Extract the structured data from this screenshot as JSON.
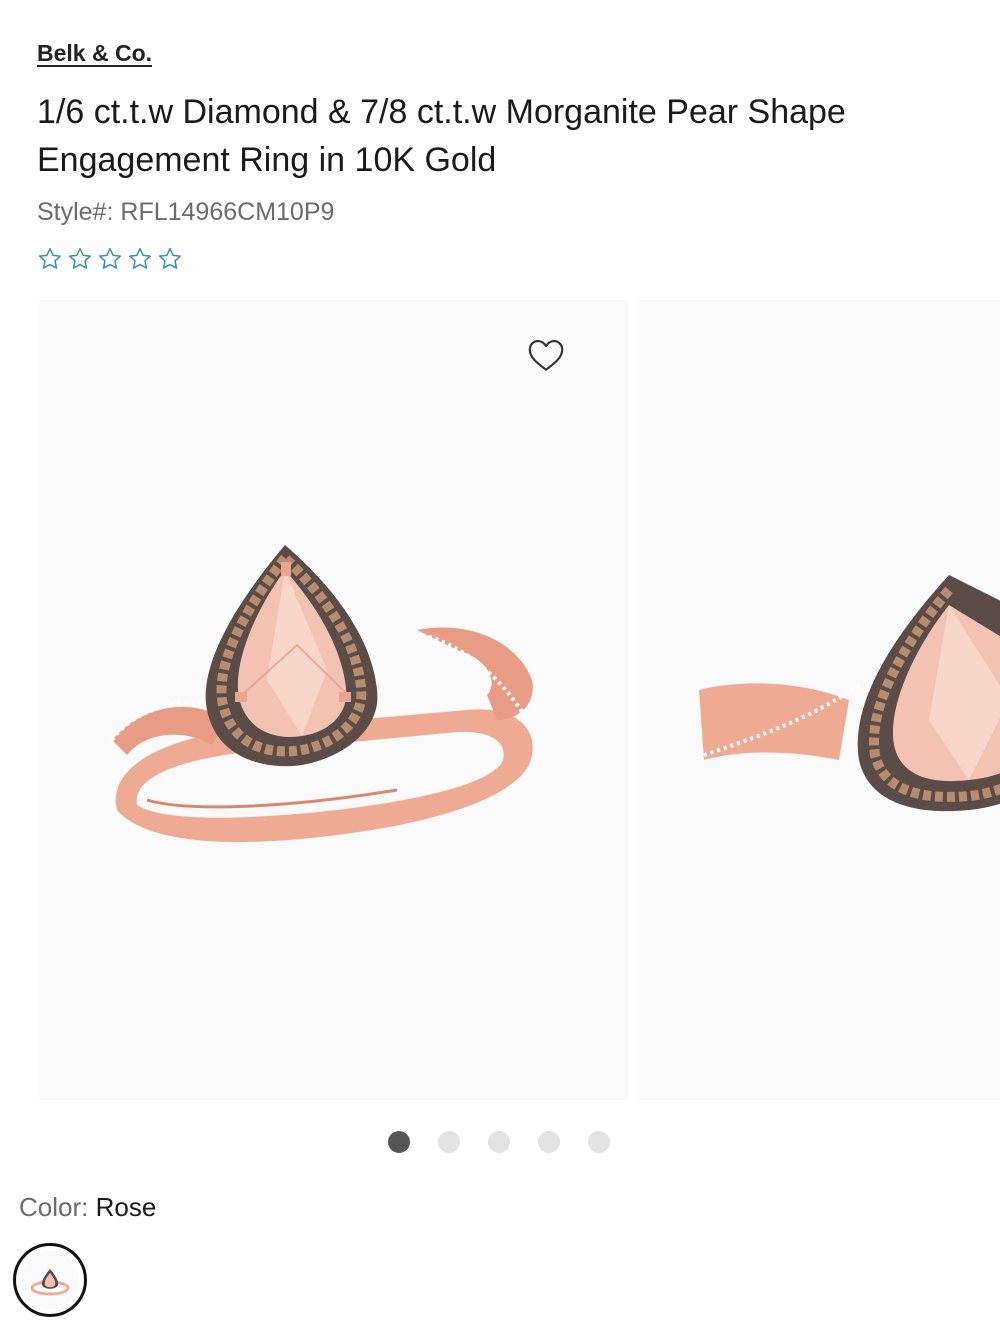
{
  "brand": "Belk & Co.",
  "product": {
    "title": "1/6 ct.t.w Diamond & 7/8 ct.t.w Morganite Pear Shape Engagement Ring in 10K Gold",
    "style_label": "Style#:",
    "style_number": "RFL14966CM10P9",
    "rating": {
      "value": 0,
      "max": 5,
      "color": "#3a8dbf"
    }
  },
  "gallery": {
    "slide_count": 5,
    "active_index": 0,
    "wishlist_icon": "heart-outline-icon"
  },
  "color": {
    "label": "Color:",
    "value": "Rose",
    "metal_color": "#e9a58f",
    "stone_color": "#f3c2b3"
  }
}
